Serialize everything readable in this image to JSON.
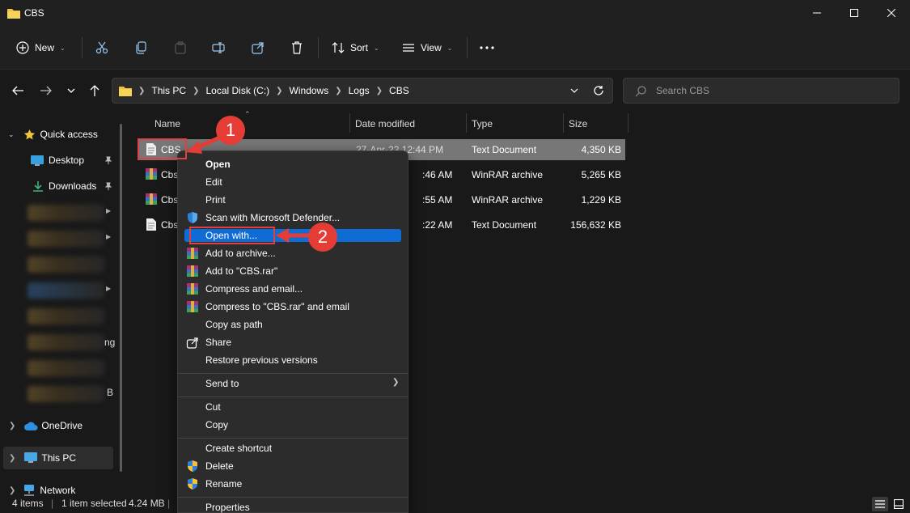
{
  "window": {
    "title": "CBS"
  },
  "toolbar": {
    "new_label": "New",
    "sort_label": "Sort",
    "view_label": "View"
  },
  "address": {
    "crumbs": [
      "This PC",
      "Local Disk (C:)",
      "Windows",
      "Logs",
      "CBS"
    ]
  },
  "search": {
    "placeholder": "Search CBS"
  },
  "sidebar": {
    "quick_access": "Quick access",
    "desktop": "Desktop",
    "downloads": "Downloads",
    "partial_1": "ng",
    "partial_2": "B",
    "onedrive": "OneDrive",
    "this_pc": "This PC",
    "network": "Network"
  },
  "columns": {
    "name": "Name",
    "date": "Date modified",
    "type": "Type",
    "size": "Size"
  },
  "files": [
    {
      "name": "CBS",
      "date": "27-Apr-22 12:44 PM",
      "type": "Text Document",
      "size": "4,350 KB"
    },
    {
      "name": "Cbs",
      "date": ":46 AM",
      "type": "WinRAR archive",
      "size": "5,265 KB"
    },
    {
      "name": "Cbs",
      "date": ":55 AM",
      "type": "WinRAR archive",
      "size": "1,229 KB"
    },
    {
      "name": "Cbs",
      "date": ":22 AM",
      "type": "Text Document",
      "size": "156,632 KB"
    }
  ],
  "status": {
    "count": "4 items",
    "selected": "1 item selected",
    "size": "4.24 MB"
  },
  "context_menu": {
    "open": "Open",
    "edit": "Edit",
    "print": "Print",
    "scan": "Scan with Microsoft Defender...",
    "open_with": "Open with...",
    "add_archive": "Add to archive...",
    "add_rar": "Add to \"CBS.rar\"",
    "compress_email": "Compress and email...",
    "compress_rar_email": "Compress to \"CBS.rar\" and email",
    "copy_path": "Copy as path",
    "share": "Share",
    "restore": "Restore previous versions",
    "send_to": "Send to",
    "cut": "Cut",
    "copy": "Copy",
    "create_shortcut": "Create shortcut",
    "delete": "Delete",
    "rename": "Rename",
    "properties": "Properties"
  },
  "annotations": {
    "step1": "1",
    "step2": "2"
  },
  "colors": {
    "accent": "#0f6cd4",
    "annotation": "#e53c35",
    "folder": "#f0c040"
  }
}
